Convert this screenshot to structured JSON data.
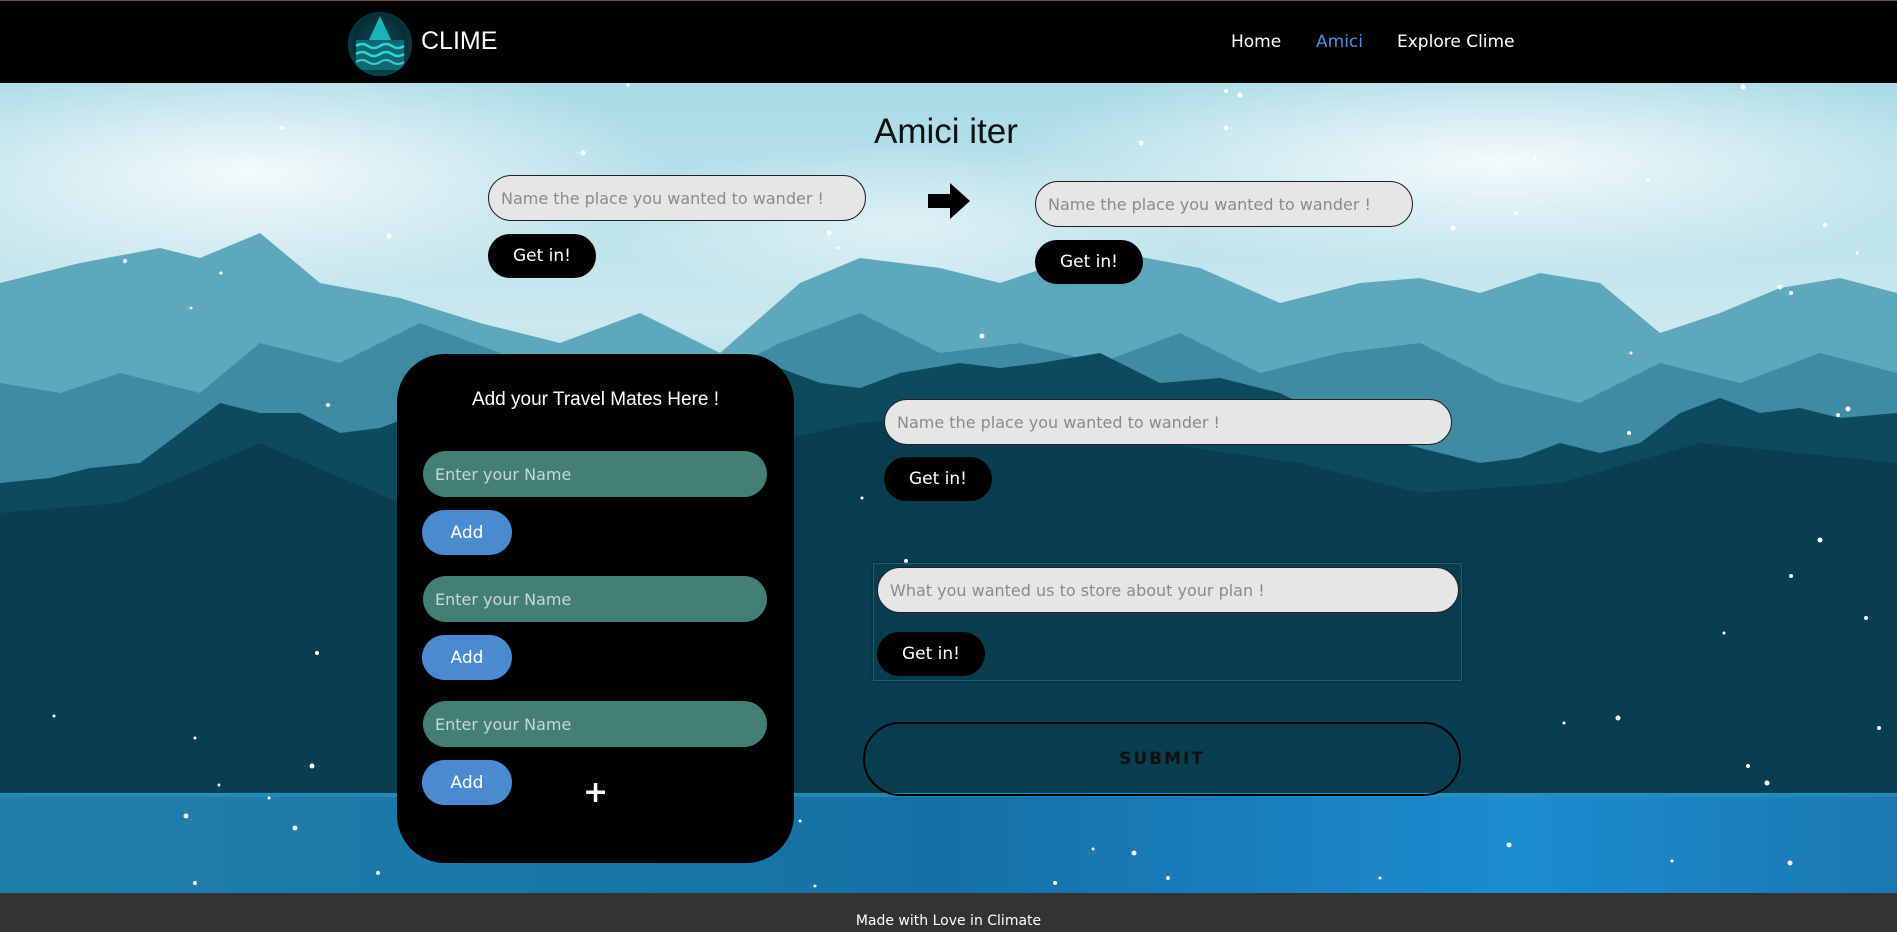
{
  "navbar": {
    "brand": "CLIME",
    "links": [
      {
        "label": "Home",
        "active": false
      },
      {
        "label": "Amici",
        "active": true
      },
      {
        "label": "Explore Clime",
        "active": false
      }
    ]
  },
  "page": {
    "title": "Amici iter"
  },
  "planner": {
    "from": {
      "placeholder": "Name the place you wanted to wander !",
      "button": "Get in!"
    },
    "to": {
      "placeholder": "Name the place you wanted to wander !",
      "button": "Get in!"
    },
    "place": {
      "placeholder": "Name the place you wanted to wander !",
      "button": "Get in!"
    },
    "notes": {
      "placeholder": "What you wanted us to store about your plan !",
      "button": "Get in!"
    },
    "submit_label": "SUBMIT"
  },
  "mates": {
    "title": "Add your Travel Mates Here !",
    "items": [
      {
        "placeholder": "Enter your Name",
        "button": "Add"
      },
      {
        "placeholder": "Enter your Name",
        "button": "Add"
      },
      {
        "placeholder": "Enter your Name",
        "button": "Add"
      }
    ],
    "add_more_icon": "plus-icon"
  },
  "footer": {
    "text": "Made with Love in Climate"
  },
  "colors": {
    "nav_bg": "#000000",
    "active_link": "#4a8fe0",
    "mate_input": "#437f76",
    "add_button": "#4a8ad0",
    "footer_bg": "#333333"
  }
}
